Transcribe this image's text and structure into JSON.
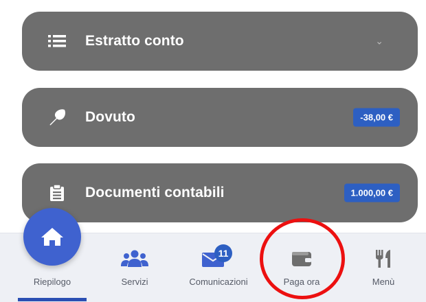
{
  "cards": [
    {
      "title": "Estratto conto",
      "icon": "list-icon",
      "chevron": "⌄"
    },
    {
      "title": "Dovuto",
      "icon": "pin-icon",
      "badge": "-38,00 €"
    },
    {
      "title": "Documenti contabili",
      "icon": "clipboard-icon",
      "badge": "1.000,00 €"
    }
  ],
  "nav": {
    "items": [
      {
        "label": "Riepilogo",
        "icon": "home-icon"
      },
      {
        "label": "Servizi",
        "icon": "users-icon"
      },
      {
        "label": "Comunicazioni",
        "icon": "envelope-icon",
        "badge": "11"
      },
      {
        "label": "Paga ora",
        "icon": "wallet-icon"
      },
      {
        "label": "Menù",
        "icon": "utensils-icon"
      }
    ]
  },
  "colors": {
    "card_bg": "#6e6e6e",
    "accent": "#3f62cf",
    "badge_bg": "#2d5fc2",
    "highlight_ring": "#ec1010"
  }
}
